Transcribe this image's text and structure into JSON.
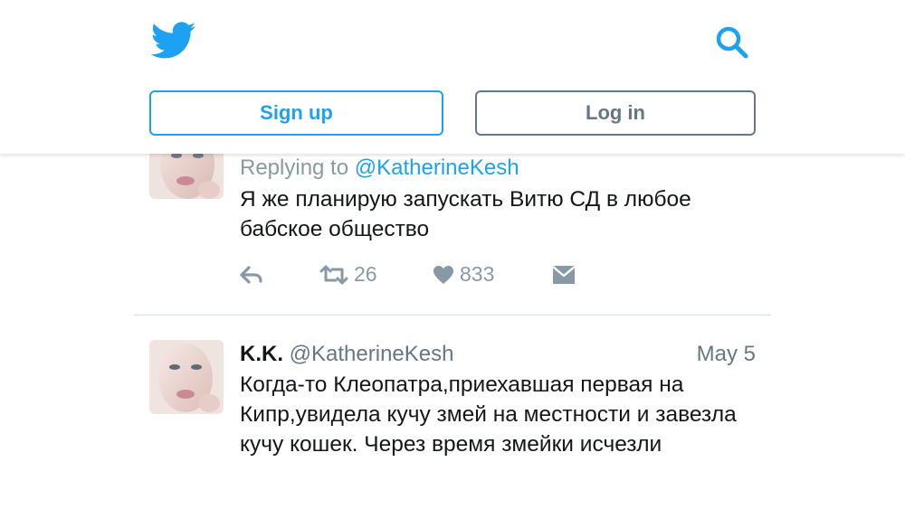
{
  "header": {
    "logo_icon": "twitter-bird-icon",
    "search_icon": "search-icon",
    "signup_label": "Sign up",
    "login_label": "Log in",
    "accent_color": "#1da1f2"
  },
  "tweets": [
    {
      "replying_prefix": "Replying to",
      "replying_handle": "@KatherineKesh",
      "text": "Я же планирую запускать Витю СД в любое бабское общество",
      "retweets": "26",
      "likes": "833"
    },
    {
      "name": "K.K.",
      "handle": "@KatherineKesh",
      "date": "May 5",
      "text": "Когда-то Клеопатра,приехавшая первая на Кипр,увидела кучу змей на местности и завезла кучу кошек. Через время змейки исчезли"
    }
  ]
}
